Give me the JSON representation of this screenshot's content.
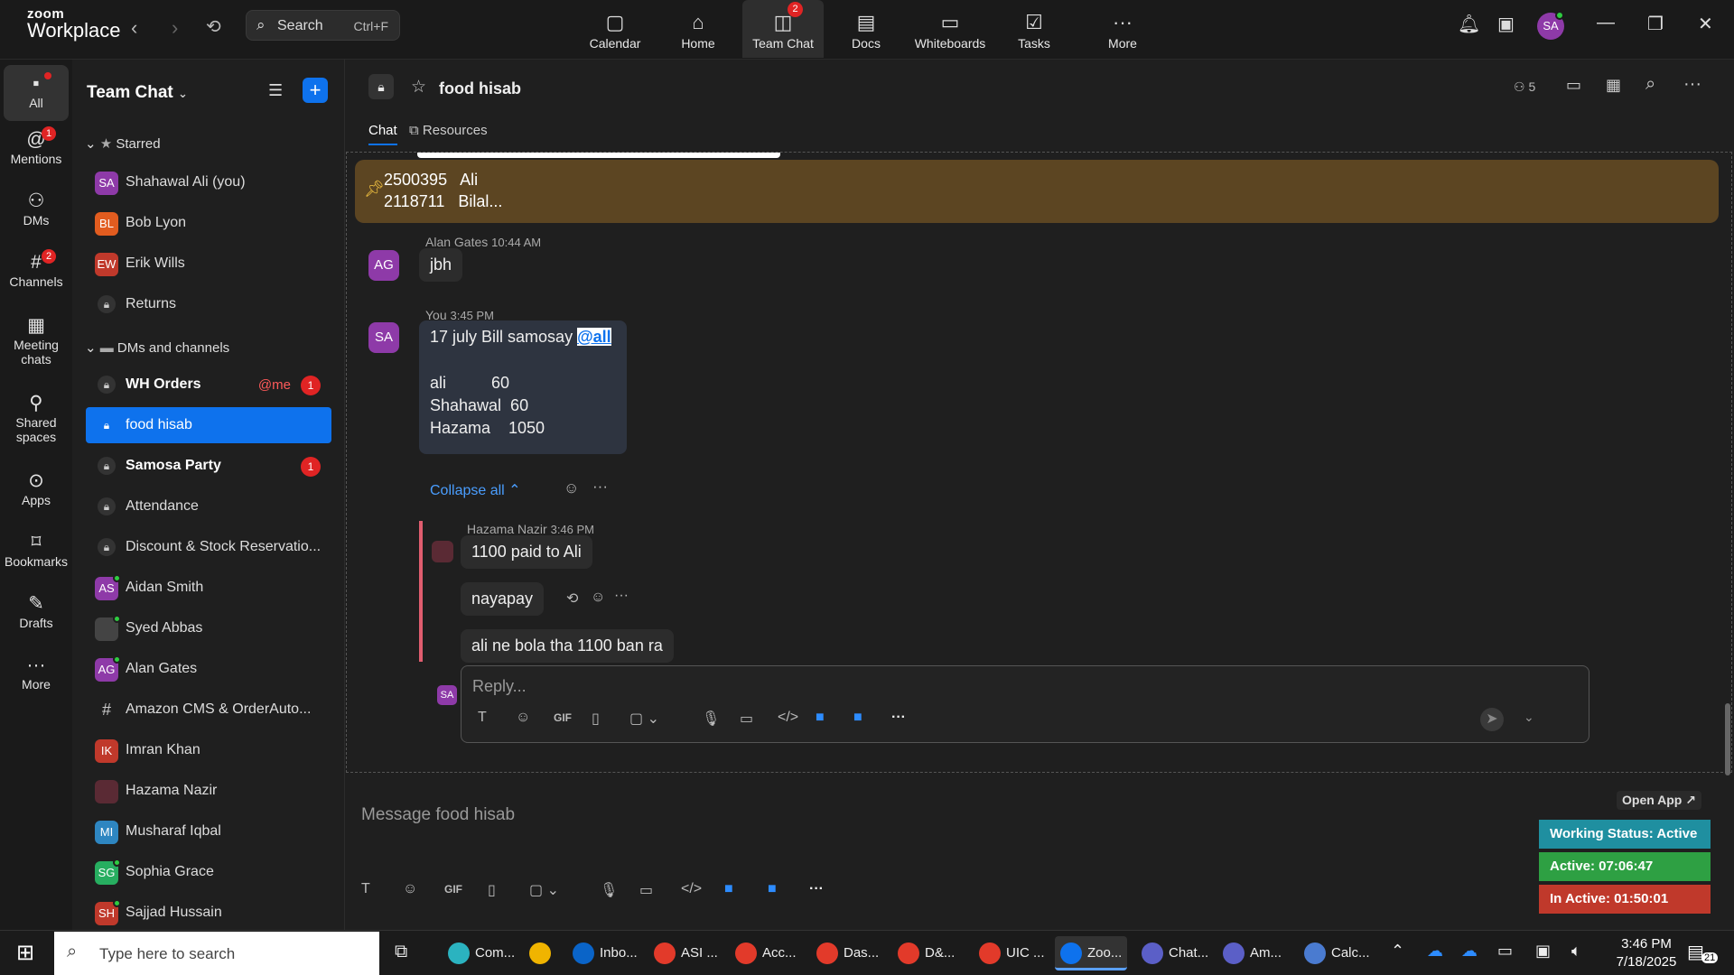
{
  "app": {
    "logo_top": "zoom",
    "logo_bottom": "Workplace"
  },
  "topbar": {
    "search_label": "Search",
    "search_shortcut": "Ctrl+F",
    "nav": [
      {
        "label": "Calendar",
        "icon": "calendar-icon",
        "glyph": "▢"
      },
      {
        "label": "Home",
        "icon": "home-icon",
        "glyph": "⌂"
      },
      {
        "label": "Team Chat",
        "icon": "chat-icon",
        "glyph": "💬",
        "badge": "2"
      },
      {
        "label": "Docs",
        "icon": "docs-icon",
        "glyph": "▤"
      },
      {
        "label": "Whiteboards",
        "icon": "whiteboard-icon",
        "glyph": "▭"
      },
      {
        "label": "Tasks",
        "icon": "tasks-icon",
        "glyph": "☑"
      },
      {
        "label": "More",
        "icon": "more-icon",
        "glyph": "···"
      }
    ],
    "avatar": "SA"
  },
  "rail": [
    {
      "label": "All",
      "icon": "chat-bubble-icon",
      "glyph": "▪"
    },
    {
      "label": "Mentions",
      "icon": "at-icon",
      "glyph": "@",
      "badge": "1"
    },
    {
      "label": "DMs",
      "icon": "people-icon",
      "glyph": "⚇"
    },
    {
      "label": "Channels",
      "icon": "hash-icon",
      "glyph": "#",
      "badge": "2"
    },
    {
      "label": "Meeting chats",
      "icon": "meeting-icon",
      "glyph": "▦"
    },
    {
      "label": "Shared spaces",
      "icon": "shared-spaces-icon",
      "glyph": "⚲"
    },
    {
      "label": "Apps",
      "icon": "apps-icon",
      "glyph": "⊙"
    },
    {
      "label": "Bookmarks",
      "icon": "bookmark-icon",
      "glyph": "⌑"
    },
    {
      "label": "Drafts",
      "icon": "drafts-icon",
      "glyph": "✎"
    },
    {
      "label": "More",
      "icon": "more-icon",
      "glyph": "···"
    }
  ],
  "sidebar": {
    "title": "Team Chat",
    "starred_label": "Starred",
    "dms_label": "DMs and channels",
    "starred": [
      {
        "name": "Shahawal Ali (you)",
        "initials": "SA",
        "color": "#8e3aa8"
      },
      {
        "name": "Bob Lyon",
        "initials": "BL",
        "color": "#e25c1f"
      },
      {
        "name": "Erik Wills",
        "initials": "EW",
        "color": "#c0392b"
      },
      {
        "name": "Returns",
        "lock": true
      }
    ],
    "channels": [
      {
        "name": "WH Orders",
        "lock": true,
        "bold": true,
        "atme": "@me",
        "badge": "1"
      },
      {
        "name": "food hisab",
        "lock": true,
        "selected": true
      },
      {
        "name": "Samosa Party",
        "lock": true,
        "bold": true,
        "badge": "1"
      },
      {
        "name": "Attendance",
        "lock": true
      },
      {
        "name": "Discount & Stock Reservatio...",
        "lock": true
      },
      {
        "name": "Aidan Smith",
        "initials": "AS",
        "color": "#8e3aa8",
        "online": true
      },
      {
        "name": "Syed Abbas",
        "initials": "",
        "color": "#444",
        "online": true
      },
      {
        "name": "Alan Gates",
        "initials": "AG",
        "color": "#8e3aa8",
        "online": true
      },
      {
        "name": "Amazon CMS & OrderAuto...",
        "hash": true
      },
      {
        "name": "Imran Khan",
        "initials": "IK",
        "color": "#c0392b"
      },
      {
        "name": "Hazama Nazir",
        "initials": "",
        "color": "#5a2a34"
      },
      {
        "name": "Musharaf Iqbal",
        "initials": "MI",
        "color": "#2e86c1"
      },
      {
        "name": "Sophia Grace",
        "initials": "SG",
        "color": "#27ae60",
        "online": true
      },
      {
        "name": "Sajjad Hussain",
        "initials": "SH",
        "color": "#c0392b",
        "online": true
      }
    ]
  },
  "channel": {
    "name": "food hisab",
    "members": "5",
    "tabs": [
      "Chat",
      "Resources"
    ],
    "pinned_line1": "2500395   Ali",
    "pinned_line2": "2118711   Bilal...",
    "msg1": {
      "author": "Alan Gates",
      "time": "10:44 AM",
      "initials": "AG",
      "text": "jbh"
    },
    "msg2": {
      "author": "You",
      "time": "3:45 PM",
      "initials": "SA",
      "line1": "17 july Bill samosay ",
      "mention": "@all",
      "body": "ali          60\nShahawal  60\nHazama    1050"
    },
    "collapse": "Collapse all",
    "reply_author": "Hazama Nazir",
    "reply_time": "3:46 PM",
    "replies": [
      "1100 paid to Ali",
      "nayapay",
      "ali ne bola tha 1100 ban ra"
    ],
    "reply_placeholder": "Reply...",
    "composer_placeholder": "Message food hisab",
    "reply_avatar": "SA"
  },
  "status": {
    "open_app": "Open App ↗",
    "working": "Working Status: Active",
    "active": "Active: 07:06:47",
    "inactive": "In Active: 01:50:01",
    "colors": {
      "working": "#1f8fa0",
      "active": "#2ea043",
      "inactive": "#c0392b"
    }
  },
  "taskbar": {
    "search": "Type here to search",
    "apps": [
      {
        "label": "Com...",
        "color": "#2bb3c0"
      },
      {
        "label": "",
        "color": "#f0b400"
      },
      {
        "label": "Inbo...",
        "color": "#0a64c8"
      },
      {
        "label": "ASI ...",
        "color": "#e23a2a"
      },
      {
        "label": "Acc...",
        "color": "#e23a2a"
      },
      {
        "label": "Das...",
        "color": "#e23a2a"
      },
      {
        "label": "D&...",
        "color": "#e23a2a"
      },
      {
        "label": "UIC ...",
        "color": "#e23a2a"
      },
      {
        "label": "Zoo...",
        "color": "#0e72ed",
        "active": true
      },
      {
        "label": "Chat...",
        "color": "#5b5fc7"
      },
      {
        "label": "Am...",
        "color": "#5b5fc7"
      },
      {
        "label": "Calc...",
        "color": "#4a7bd0"
      }
    ],
    "time": "3:46 PM",
    "date": "7/18/2025",
    "notif": "21"
  }
}
